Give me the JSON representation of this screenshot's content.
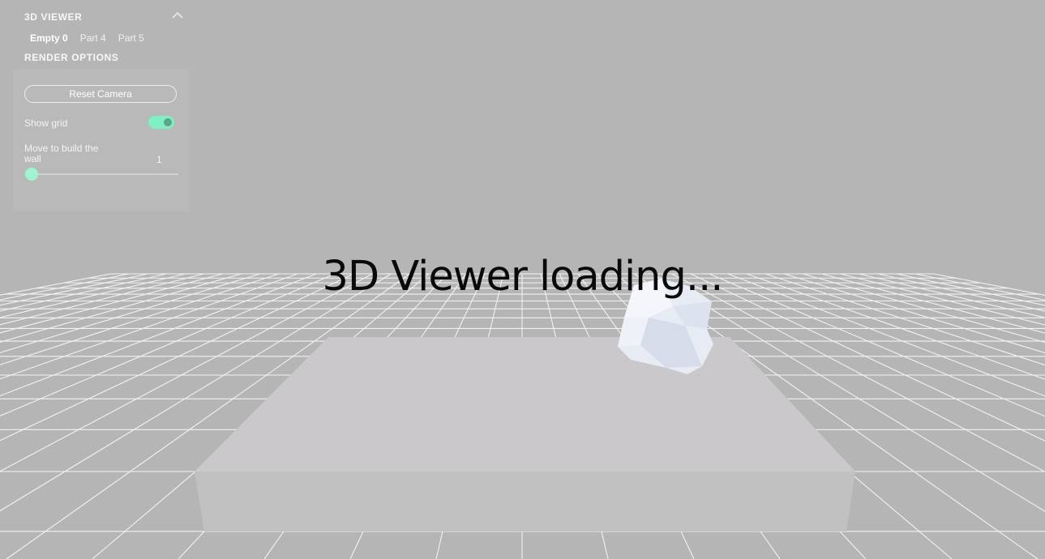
{
  "panel": {
    "title": "3D VIEWER",
    "tabs": [
      {
        "label": "Empty 0",
        "active": true
      },
      {
        "label": "Part 4",
        "active": false
      },
      {
        "label": "Part 5",
        "active": false
      }
    ],
    "render_options": {
      "title": "RENDER OPTIONS",
      "reset_label": "Reset Camera",
      "show_grid_label": "Show grid",
      "show_grid": true,
      "slider_label": "Move to build the wall",
      "slider_value": "1"
    }
  },
  "viewer": {
    "loading_text": "3D Viewer loading..."
  },
  "colors": {
    "background": "#b5b5b5",
    "accent": "#7ff0c4",
    "slab": "#c9c6c9",
    "rock": "#e7ecf5"
  },
  "icons": {
    "collapse": "chevron-up-icon"
  }
}
